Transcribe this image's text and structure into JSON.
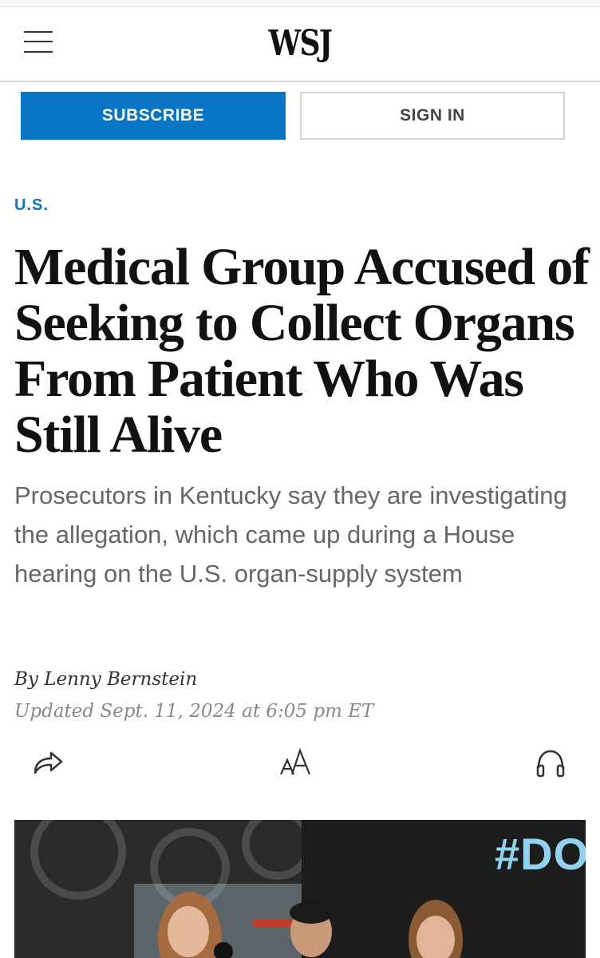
{
  "header": {
    "logo": "WSJ",
    "menu_icon": "hamburger-menu-icon"
  },
  "actions": {
    "subscribe_label": "SUBSCRIBE",
    "sign_in_label": "SIGN IN"
  },
  "article": {
    "section": "U.S.",
    "headline": "Medical Group Accused of Seeking to Collect Organs From Patient Who Was Still Alive",
    "dek": "Prosecutors in Kentucky say they are investigating the allegation, which came up during a House hearing on the U.S. organ-supply system",
    "byline_prefix": "By",
    "author": "Lenny Bernstein",
    "updated": "Updated Sept. 11, 2024 at 6:05 pm ET"
  },
  "toolbar": {
    "share_icon": "share-icon",
    "text_size_icon": "text-size-icon",
    "listen_icon": "headphones-icon"
  },
  "hero_image": {
    "visible_text": "#DON"
  },
  "colors": {
    "brand_blue": "#0874c4",
    "headline": "#111111",
    "dek": "#666666",
    "date": "#888888"
  }
}
